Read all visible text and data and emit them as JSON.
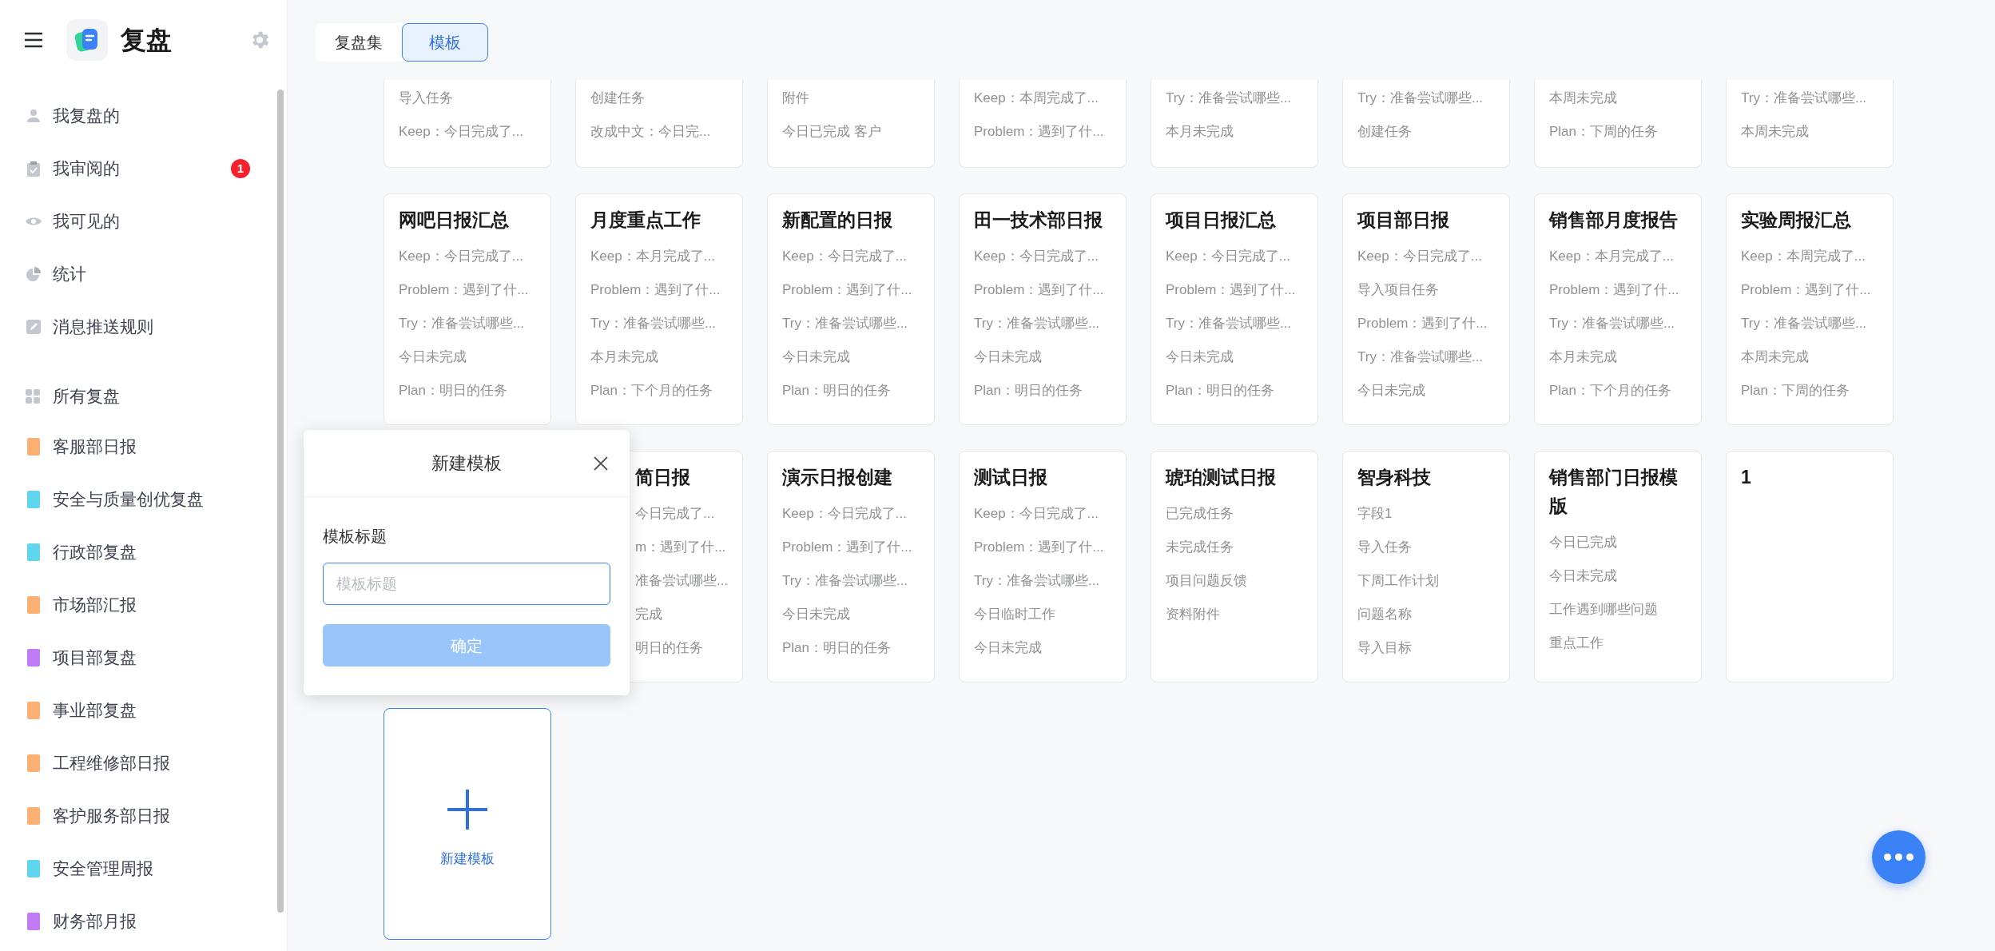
{
  "sidebar": {
    "title": "复盘",
    "nav": [
      {
        "label": "我复盘的"
      },
      {
        "label": "我审阅的",
        "badge": "1"
      },
      {
        "label": "我可见的"
      },
      {
        "label": "统计"
      },
      {
        "label": "消息推送规则"
      }
    ],
    "group": {
      "label": "所有复盘"
    },
    "boards": [
      {
        "label": "客服部日报",
        "color": "#fdb073"
      },
      {
        "label": "安全与质量创优复盘",
        "color": "#5fd6ee"
      },
      {
        "label": "行政部复盘",
        "color": "#5fd6ee"
      },
      {
        "label": "市场部汇报",
        "color": "#fdb073"
      },
      {
        "label": "项目部复盘",
        "color": "#c17cf5"
      },
      {
        "label": "事业部复盘",
        "color": "#fdb073"
      },
      {
        "label": "工程维修部日报",
        "color": "#fdb073"
      },
      {
        "label": "客护服务部日报",
        "color": "#fdb073"
      },
      {
        "label": "安全管理周报",
        "color": "#5fd6ee"
      },
      {
        "label": "财务部月报",
        "color": "#c17cf5"
      }
    ]
  },
  "tabs": [
    {
      "label": "复盘集",
      "selected": false
    },
    {
      "label": "模板",
      "selected": true
    }
  ],
  "templates": [
    {
      "kind": "clipped",
      "lines": [
        "导入任务",
        "Keep：今日完成了..."
      ]
    },
    {
      "kind": "clipped",
      "lines": [
        "创建任务",
        "改成中文：今日完..."
      ]
    },
    {
      "kind": "clipped",
      "lines": [
        "附件",
        "今日已完成 客户"
      ]
    },
    {
      "kind": "clipped",
      "lines": [
        "Keep：本周完成了...",
        "Problem：遇到了什..."
      ]
    },
    {
      "kind": "clipped",
      "lines": [
        "Try：准备尝试哪些...",
        "本月未完成"
      ]
    },
    {
      "kind": "clipped",
      "lines": [
        "Try：准备尝试哪些...",
        "创建任务"
      ]
    },
    {
      "kind": "clipped",
      "lines": [
        "本周未完成",
        "Plan：下周的任务"
      ]
    },
    {
      "kind": "clipped",
      "lines": [
        "Try：准备尝试哪些...",
        "本周未完成"
      ]
    },
    {
      "kind": "card",
      "title": "网吧日报汇总",
      "lines": [
        "Keep：今日完成了...",
        "Problem：遇到了什...",
        "Try：准备尝试哪些...",
        "今日未完成",
        "Plan：明日的任务"
      ]
    },
    {
      "kind": "card",
      "title": "月度重点工作",
      "lines": [
        "Keep：本月完成了...",
        "Problem：遇到了什...",
        "Try：准备尝试哪些...",
        "本月未完成",
        "Plan：下个月的任务"
      ]
    },
    {
      "kind": "card",
      "title": "新配置的日报",
      "lines": [
        "Keep：今日完成了...",
        "Problem：遇到了什...",
        "Try：准备尝试哪些...",
        "今日未完成",
        "Plan：明日的任务"
      ]
    },
    {
      "kind": "card",
      "title": "田一技术部日报",
      "lines": [
        "Keep：今日完成了...",
        "Problem：遇到了什...",
        "Try：准备尝试哪些...",
        "今日未完成",
        "Plan：明日的任务"
      ]
    },
    {
      "kind": "card",
      "title": "项目日报汇总",
      "lines": [
        "Keep：今日完成了...",
        "Problem：遇到了什...",
        "Try：准备尝试哪些...",
        "今日未完成",
        "Plan：明日的任务"
      ]
    },
    {
      "kind": "card",
      "title": "项目部日报",
      "lines": [
        "Keep：今日完成了...",
        "导入项目任务",
        "Problem：遇到了什...",
        "Try：准备尝试哪些...",
        "今日未完成"
      ]
    },
    {
      "kind": "card",
      "title": "销售部月度报告",
      "lines": [
        "Keep：本月完成了...",
        "Problem：遇到了什...",
        "Try：准备尝试哪些...",
        "本月未完成",
        "Plan：下个月的任务"
      ]
    },
    {
      "kind": "card",
      "title": "实验周报汇总",
      "lines": [
        "Keep：本周完成了...",
        "Problem：遇到了什...",
        "Try：准备尝试哪些...",
        "本周未完成",
        "Plan：下周的任务"
      ]
    },
    {
      "kind": "covered",
      "title": "简日报",
      "lines": [
        "今日完成了...",
        "m：遇到了什...",
        "准备尝试哪些...",
        "完成",
        "明日的任务"
      ]
    },
    {
      "kind": "card",
      "title": "演示日报创建",
      "lines": [
        "Keep：今日完成了...",
        "Problem：遇到了什...",
        "Try：准备尝试哪些...",
        "今日未完成",
        "Plan：明日的任务"
      ]
    },
    {
      "kind": "card",
      "title": "测试日报",
      "lines": [
        "Keep：今日完成了...",
        "Problem：遇到了什...",
        "Try：准备尝试哪些...",
        "今日临时工作",
        "今日未完成"
      ]
    },
    {
      "kind": "card",
      "title": "琥珀测试日报",
      "lines": [
        "已完成任务",
        "未完成任务",
        "项目问题反馈",
        "资料附件"
      ]
    },
    {
      "kind": "card",
      "title": "智身科技",
      "lines": [
        "字段1",
        "导入任务",
        "下周工作计划",
        "问题名称",
        "导入目标"
      ]
    },
    {
      "kind": "card",
      "title": "销售部门日报模版",
      "lines": [
        "今日已完成",
        "今日未完成",
        "工作遇到哪些问题",
        "重点工作"
      ]
    },
    {
      "kind": "card",
      "title": "1"
    }
  ],
  "new_template": {
    "label": "新建模板"
  },
  "dialog": {
    "title": "新建模板",
    "field_label": "模板标题",
    "placeholder": "模板标题",
    "confirm": {
      "label": "确定",
      "disabled": true
    }
  }
}
